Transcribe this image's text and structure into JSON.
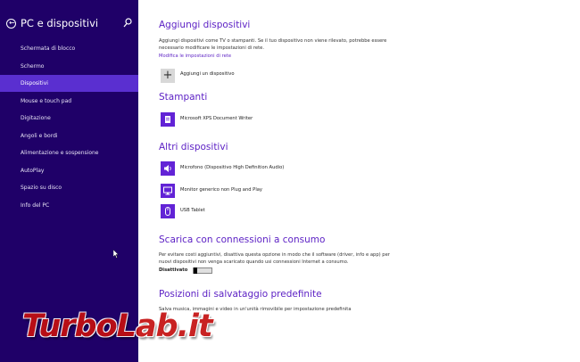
{
  "sidebar": {
    "title": "PC e dispositivi",
    "items": [
      {
        "label": "Schermata di blocco"
      },
      {
        "label": "Schermo"
      },
      {
        "label": "Dispositivi"
      },
      {
        "label": "Mouse e touch pad"
      },
      {
        "label": "Digitazione"
      },
      {
        "label": "Angoli e bordi"
      },
      {
        "label": "Alimentazione e sospensione"
      },
      {
        "label": "AutoPlay"
      },
      {
        "label": "Spazio su disco"
      },
      {
        "label": "Info del PC"
      }
    ],
    "active_index": 2
  },
  "main": {
    "add_section": {
      "title": "Aggiungi dispositivi",
      "description": "Aggiungi dispositivi come TV o stampanti. Se il tuo dispositivo non viene rilevato, potrebbe essere necessario modificare le impostazioni di rete.",
      "link": "Modifica le impostazioni di rete",
      "add_button": "Aggiungi un dispositivo"
    },
    "printers": {
      "title": "Stampanti",
      "devices": [
        "Microsoft XPS Document Writer"
      ]
    },
    "other": {
      "title": "Altri dispositivi",
      "devices": [
        "Microfono (Dispositivo High Definition Audio)",
        "Monitor generico non Plug and Play",
        "USB Tablet"
      ]
    },
    "metered": {
      "title": "Scarica con connessioni a consumo",
      "description": "Per evitare costi aggiuntivi, disattiva questa opzione in modo che il software (driver, info e app) per nuovi dispositivi non venga scaricato quando usi connessioni Internet a consumo.",
      "toggle_label": "Disattivato",
      "toggle_on": false
    },
    "save_locations": {
      "title": "Posizioni di salvataggio predefinite",
      "description": "Salva musica, immagini e video in un'unità rimovibile per impostazione predefinita"
    }
  },
  "watermark": {
    "text": "TurboLab.it"
  },
  "colors": {
    "sidebar_bg": "#1f0068",
    "active_item": "#5a2fd0",
    "accent": "#5b1fc4",
    "watermark": "#c41010"
  }
}
